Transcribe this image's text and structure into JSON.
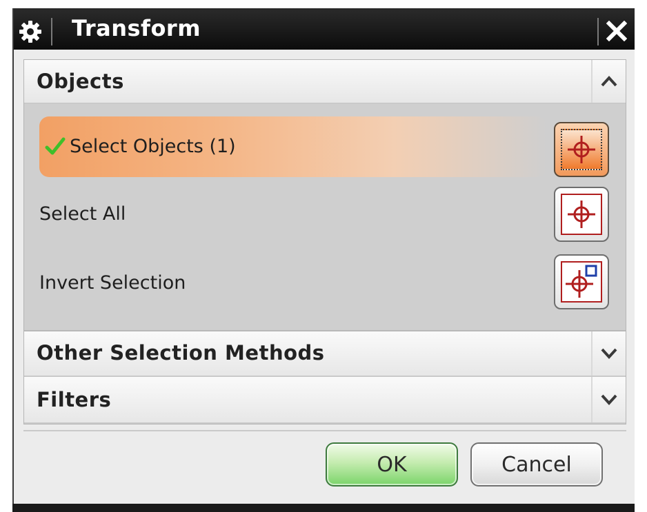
{
  "window": {
    "title": "Transform",
    "icon": "gear-icon",
    "close_icon": "close-icon"
  },
  "groups": {
    "objects": {
      "label": "Objects",
      "expanded": true,
      "toggle_icon": "chevron-up-icon",
      "rows": [
        {
          "label": "Select Objects (1)",
          "status_icon": "checkmark-icon",
          "button_icon": "crosshair-select-icon",
          "active": true
        },
        {
          "label": "Select All",
          "button_icon": "crosshair-select-all-icon",
          "active": false
        },
        {
          "label": "Invert Selection",
          "button_icon": "crosshair-invert-icon",
          "active": false
        }
      ]
    },
    "other_selection_methods": {
      "label": "Other Selection Methods",
      "expanded": false,
      "toggle_icon": "chevron-down-icon"
    },
    "filters": {
      "label": "Filters",
      "expanded": false,
      "toggle_icon": "chevron-down-icon"
    }
  },
  "footer": {
    "ok_label": "OK",
    "cancel_label": "Cancel"
  },
  "colors": {
    "titlebar": "#0c0c0c",
    "highlight": "#f2a064",
    "ok_green": "#7bd46a",
    "check_green": "#3fbf2a",
    "crosshair_red": "#b01e1e"
  }
}
